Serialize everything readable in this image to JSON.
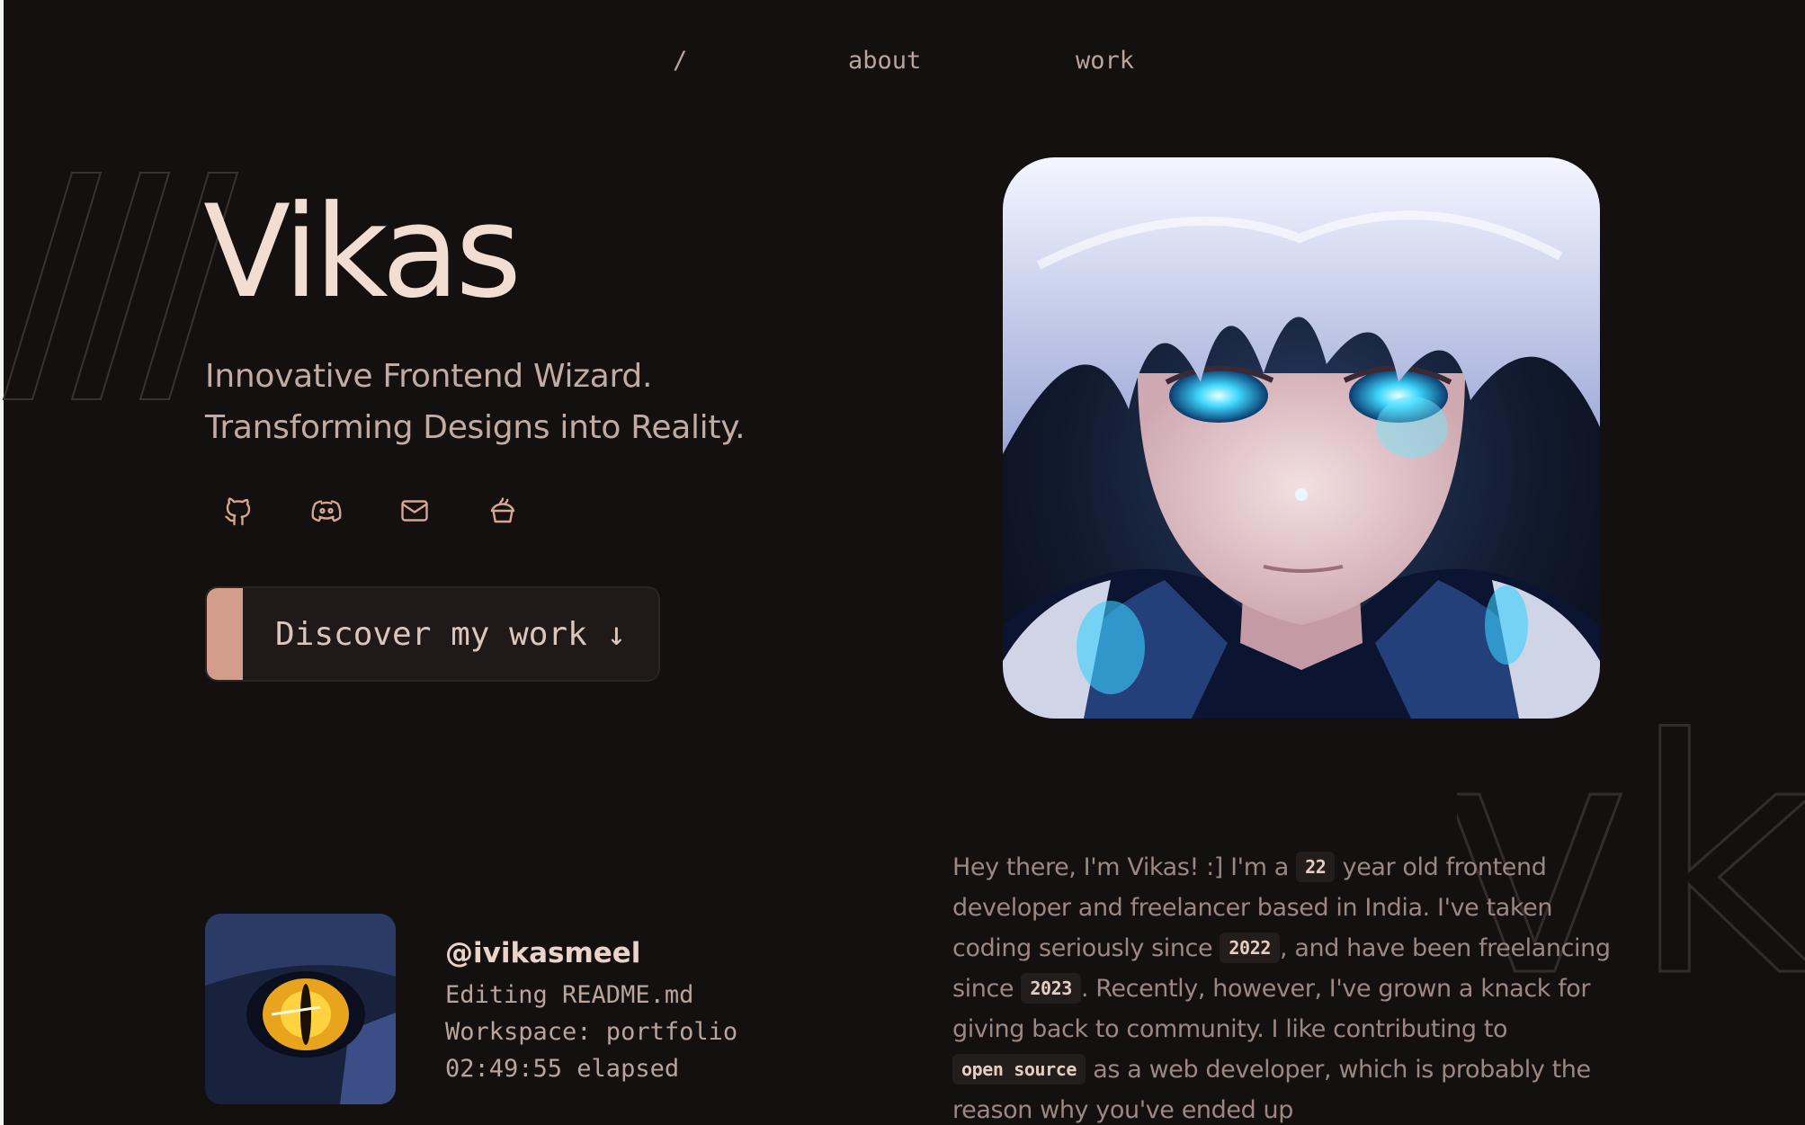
{
  "nav": {
    "home": "/",
    "about": "about",
    "work": "work"
  },
  "hero": {
    "name": "Vikas",
    "tagline_1": "Innovative Frontend Wizard.",
    "tagline_2": "Transforming Designs into Reality.",
    "cta_label": "Discover my work ↓"
  },
  "socials": [
    {
      "icon": "github-icon"
    },
    {
      "icon": "discord-icon"
    },
    {
      "icon": "mail-icon"
    },
    {
      "icon": "buymeacoffee-icon"
    }
  ],
  "watermark": "vk",
  "presence": {
    "username": "@ivikasmeel",
    "activity": "Editing README.md",
    "workspace": "Workspace: portfolio",
    "elapsed": "02:49:55 elapsed"
  },
  "about": {
    "t1": "Hey there, I'm Vikas! :] I'm a",
    "age": "22",
    "t2": "year old frontend developer and freelancer based in India. I've taken coding seriously since",
    "coding_since": "2022",
    "t3": ", and have been freelancing since",
    "freelance_since": "2023",
    "t4": ". Recently, however, I've grown a knack for giving back to community. I like contributing to",
    "oss": "open source",
    "t5": "as a web developer, which is probably the reason why you've ended up"
  },
  "colors": {
    "background": "#141010",
    "accent": "#d29e8b",
    "heading": "#f2ddd3",
    "muted": "#9c8881"
  }
}
